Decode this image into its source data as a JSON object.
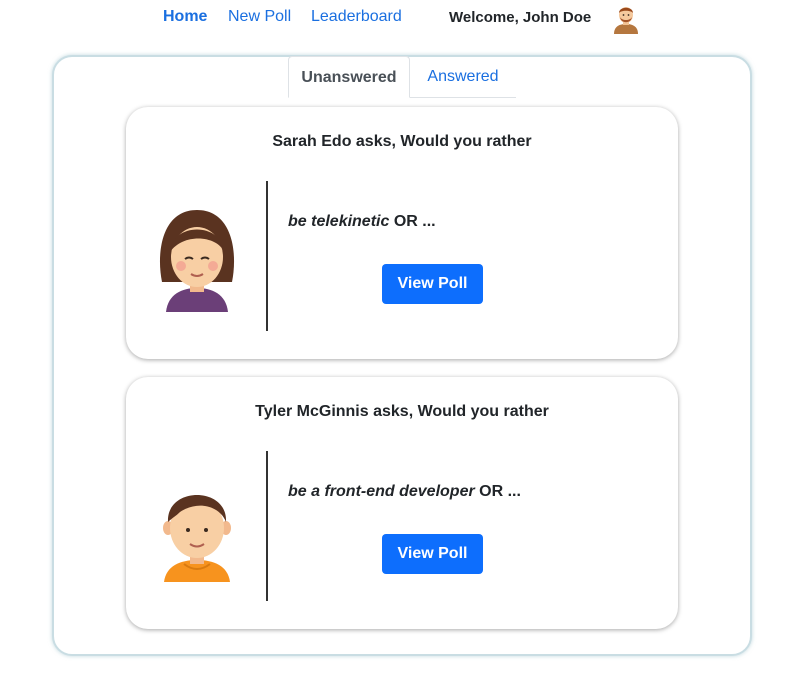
{
  "nav": {
    "links": [
      {
        "label": "Home",
        "active": true
      },
      {
        "label": "New Poll",
        "active": false
      },
      {
        "label": "Leaderboard",
        "active": false
      }
    ],
    "welcome": "Welcome, John Doe",
    "avatar_icon": "male-avatar-icon"
  },
  "tabs": [
    {
      "label": "Unanswered",
      "active": true
    },
    {
      "label": "Answered",
      "active": false
    }
  ],
  "polls": [
    {
      "title": "Sarah Edo asks, Would you rather",
      "option_text": "be telekinetic",
      "or_text": "OR ...",
      "button_label": "View Poll",
      "avatar_icon": "girl-avatar-icon"
    },
    {
      "title": "Tyler McGinnis asks, Would you rather",
      "option_text": "be a front-end developer",
      "or_text": "OR ...",
      "button_label": "View Poll",
      "avatar_icon": "boy-avatar-icon"
    }
  ],
  "colors": {
    "link": "#1a6fe0",
    "button": "#0d6efd",
    "container_border": "#c9dde3"
  }
}
